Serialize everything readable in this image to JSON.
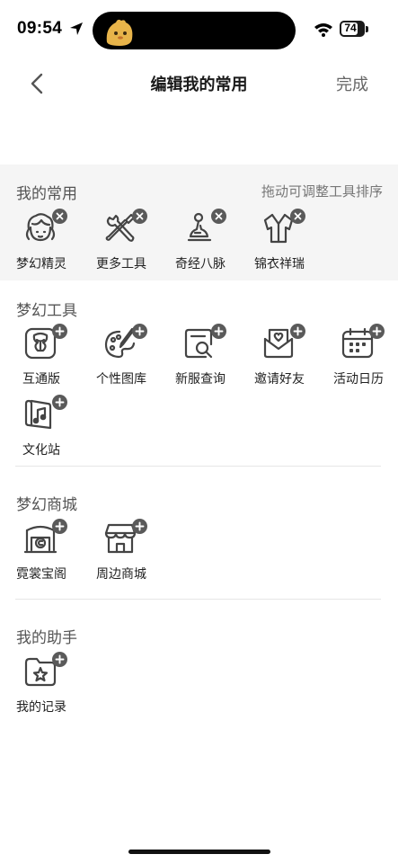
{
  "status": {
    "time": "09:54",
    "battery": "74",
    "battery_level": 0.74
  },
  "nav": {
    "title": "编辑我的常用",
    "done": "完成"
  },
  "favorites": {
    "title": "我的常用",
    "hint": "拖动可调整工具排序",
    "items": [
      {
        "label": "梦幻精灵",
        "icon": "spirit-icon"
      },
      {
        "label": "更多工具",
        "icon": "tools-icon"
      },
      {
        "label": "奇经八脉",
        "icon": "meridian-icon"
      },
      {
        "label": "锦衣祥瑞",
        "icon": "garment-icon"
      }
    ]
  },
  "tools": {
    "title": "梦幻工具",
    "items": [
      {
        "label": "互通版",
        "icon": "flower-icon"
      },
      {
        "label": "个性图库",
        "icon": "palette-icon"
      },
      {
        "label": "新服查询",
        "icon": "search-doc-icon"
      },
      {
        "label": "邀请好友",
        "icon": "invite-mail-icon"
      },
      {
        "label": "活动日历",
        "icon": "calendar-icon"
      },
      {
        "label": "文化站",
        "icon": "music-scroll-icon"
      }
    ]
  },
  "mall": {
    "title": "梦幻商城",
    "items": [
      {
        "label": "霓裳宝阁",
        "icon": "treasure-shop-icon"
      },
      {
        "label": "周边商城",
        "icon": "store-icon"
      }
    ]
  },
  "assistant": {
    "title": "我的助手",
    "items": [
      {
        "label": "我的记录",
        "icon": "star-folder-icon"
      }
    ]
  }
}
